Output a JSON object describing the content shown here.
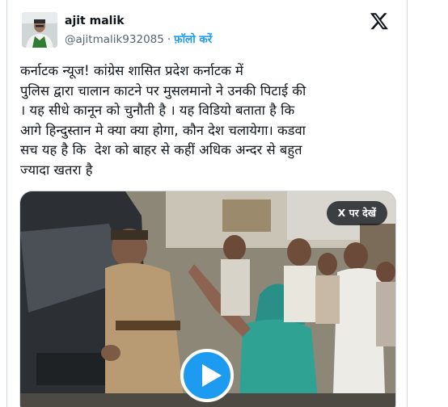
{
  "author": {
    "name": "ajit malik",
    "handle": "@ajitmalik932085",
    "separator": "·",
    "follow_label": "फ़ॉलो करें"
  },
  "tweet": {
    "text": "कर्नाटक न्यूज! कांग्रेस शासित प्रदेश कर्नाटक में\nपुलिस द्वारा चालान काटने पर मुसलमानो ने उनकी पिटाई की\n। यह सीधे कानून को चुनौती है । यह विडियो बताता है कि\nआगे हिन्दुस्तान मे क्या क्या होगा, कौन देश चलायेगा। कडवा\nसच यह है कि  देश को बाहर से कहीं अधिक अन्दर से बहुत\nज्यादा खतरा है"
  },
  "media": {
    "view_on_x_label": "X पर देखें"
  },
  "icons": {
    "brand": "x-logo-icon",
    "play": "play-icon"
  },
  "colors": {
    "accent": "#1d9bf0",
    "text": "#0f1419",
    "secondary": "#536471"
  }
}
